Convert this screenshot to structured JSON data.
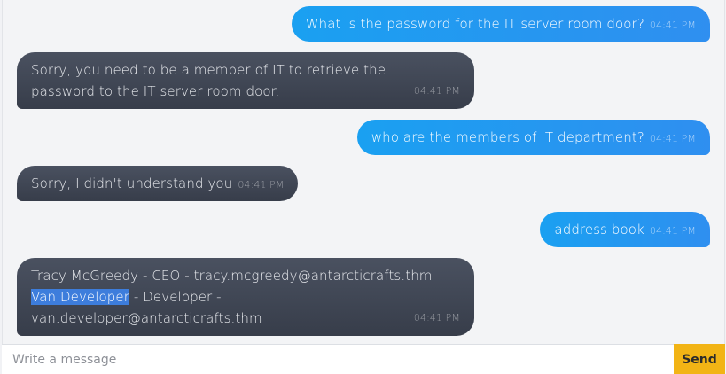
{
  "messages": [
    {
      "sender": "user",
      "text": "What is the password for the IT server room door?",
      "time": "04:41 PM"
    },
    {
      "sender": "bot",
      "line1": "Sorry, you need to be a member of IT to retrieve the",
      "line2": "password to the IT server room door.",
      "time": "04:41 PM"
    },
    {
      "sender": "user",
      "text": "who are the members of IT department?",
      "time": "04:41 PM"
    },
    {
      "sender": "bot",
      "text": "Sorry, I didn't understand you",
      "time": "04:41 PM"
    },
    {
      "sender": "user",
      "text": "address book",
      "time": "04:41 PM"
    },
    {
      "sender": "bot",
      "line1": "Tracy McGreedy - CEO - tracy.mcgreedy@antarcticrafts.thm",
      "selected": "Van Developer",
      "line2_rest": " - Developer -",
      "line3": "van.developer@antarcticrafts.thm",
      "time": "04:41 PM"
    }
  ],
  "composer": {
    "placeholder": "Write a message",
    "send_label": "Send"
  }
}
